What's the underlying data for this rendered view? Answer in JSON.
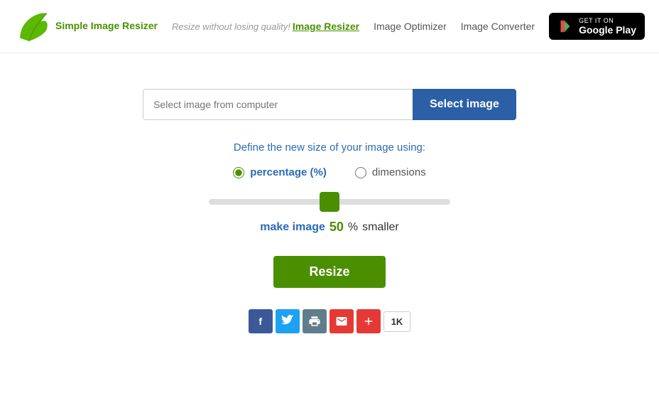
{
  "header": {
    "logo_title": "Simple Image Resizer",
    "tagline": "Resize without losing quality!",
    "nav": {
      "resizer": "Image Resizer",
      "optimizer": "Image Optimizer",
      "converter": "Image Converter"
    },
    "google_play": {
      "get_it_on": "GET IT ON",
      "store": "Google Play"
    }
  },
  "main": {
    "file_input_placeholder": "Select image from computer",
    "select_button": "Select image",
    "define_label": "Define the new size of your image using:",
    "radio_percentage": "percentage (%)",
    "radio_dimensions": "dimensions",
    "slider_value": 50,
    "slider_min": 0,
    "slider_max": 100,
    "make_image_label": "make image",
    "percent_value": "50",
    "percent_sign": "%",
    "smaller_label": "smaller",
    "resize_button": "Resize"
  },
  "social": {
    "facebook_label": "f",
    "twitter_label": "t",
    "print_label": "🖨",
    "email_label": "✉",
    "plus_label": "+",
    "count": "1K"
  },
  "icons": {
    "logo": "leaf-icon",
    "play_triangle": "play-triangle-icon"
  }
}
